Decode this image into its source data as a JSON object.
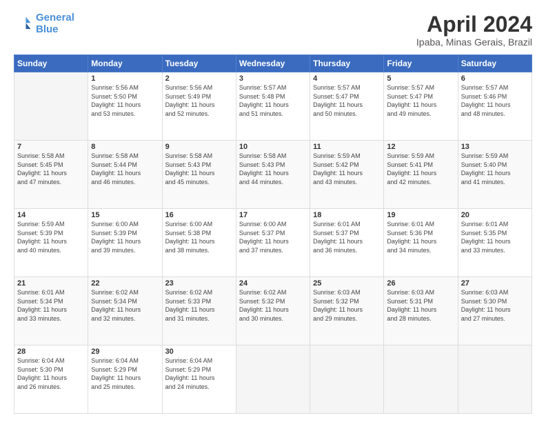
{
  "header": {
    "logo_line1": "General",
    "logo_line2": "Blue",
    "title": "April 2024",
    "subtitle": "Ipaba, Minas Gerais, Brazil"
  },
  "weekdays": [
    "Sunday",
    "Monday",
    "Tuesday",
    "Wednesday",
    "Thursday",
    "Friday",
    "Saturday"
  ],
  "weeks": [
    [
      {
        "day": "",
        "info": ""
      },
      {
        "day": "1",
        "info": "Sunrise: 5:56 AM\nSunset: 5:50 PM\nDaylight: 11 hours\nand 53 minutes."
      },
      {
        "day": "2",
        "info": "Sunrise: 5:56 AM\nSunset: 5:49 PM\nDaylight: 11 hours\nand 52 minutes."
      },
      {
        "day": "3",
        "info": "Sunrise: 5:57 AM\nSunset: 5:48 PM\nDaylight: 11 hours\nand 51 minutes."
      },
      {
        "day": "4",
        "info": "Sunrise: 5:57 AM\nSunset: 5:47 PM\nDaylight: 11 hours\nand 50 minutes."
      },
      {
        "day": "5",
        "info": "Sunrise: 5:57 AM\nSunset: 5:47 PM\nDaylight: 11 hours\nand 49 minutes."
      },
      {
        "day": "6",
        "info": "Sunrise: 5:57 AM\nSunset: 5:46 PM\nDaylight: 11 hours\nand 48 minutes."
      }
    ],
    [
      {
        "day": "7",
        "info": "Sunrise: 5:58 AM\nSunset: 5:45 PM\nDaylight: 11 hours\nand 47 minutes."
      },
      {
        "day": "8",
        "info": "Sunrise: 5:58 AM\nSunset: 5:44 PM\nDaylight: 11 hours\nand 46 minutes."
      },
      {
        "day": "9",
        "info": "Sunrise: 5:58 AM\nSunset: 5:43 PM\nDaylight: 11 hours\nand 45 minutes."
      },
      {
        "day": "10",
        "info": "Sunrise: 5:58 AM\nSunset: 5:43 PM\nDaylight: 11 hours\nand 44 minutes."
      },
      {
        "day": "11",
        "info": "Sunrise: 5:59 AM\nSunset: 5:42 PM\nDaylight: 11 hours\nand 43 minutes."
      },
      {
        "day": "12",
        "info": "Sunrise: 5:59 AM\nSunset: 5:41 PM\nDaylight: 11 hours\nand 42 minutes."
      },
      {
        "day": "13",
        "info": "Sunrise: 5:59 AM\nSunset: 5:40 PM\nDaylight: 11 hours\nand 41 minutes."
      }
    ],
    [
      {
        "day": "14",
        "info": "Sunrise: 5:59 AM\nSunset: 5:39 PM\nDaylight: 11 hours\nand 40 minutes."
      },
      {
        "day": "15",
        "info": "Sunrise: 6:00 AM\nSunset: 5:39 PM\nDaylight: 11 hours\nand 39 minutes."
      },
      {
        "day": "16",
        "info": "Sunrise: 6:00 AM\nSunset: 5:38 PM\nDaylight: 11 hours\nand 38 minutes."
      },
      {
        "day": "17",
        "info": "Sunrise: 6:00 AM\nSunset: 5:37 PM\nDaylight: 11 hours\nand 37 minutes."
      },
      {
        "day": "18",
        "info": "Sunrise: 6:01 AM\nSunset: 5:37 PM\nDaylight: 11 hours\nand 36 minutes."
      },
      {
        "day": "19",
        "info": "Sunrise: 6:01 AM\nSunset: 5:36 PM\nDaylight: 11 hours\nand 34 minutes."
      },
      {
        "day": "20",
        "info": "Sunrise: 6:01 AM\nSunset: 5:35 PM\nDaylight: 11 hours\nand 33 minutes."
      }
    ],
    [
      {
        "day": "21",
        "info": "Sunrise: 6:01 AM\nSunset: 5:34 PM\nDaylight: 11 hours\nand 33 minutes."
      },
      {
        "day": "22",
        "info": "Sunrise: 6:02 AM\nSunset: 5:34 PM\nDaylight: 11 hours\nand 32 minutes."
      },
      {
        "day": "23",
        "info": "Sunrise: 6:02 AM\nSunset: 5:33 PM\nDaylight: 11 hours\nand 31 minutes."
      },
      {
        "day": "24",
        "info": "Sunrise: 6:02 AM\nSunset: 5:32 PM\nDaylight: 11 hours\nand 30 minutes."
      },
      {
        "day": "25",
        "info": "Sunrise: 6:03 AM\nSunset: 5:32 PM\nDaylight: 11 hours\nand 29 minutes."
      },
      {
        "day": "26",
        "info": "Sunrise: 6:03 AM\nSunset: 5:31 PM\nDaylight: 11 hours\nand 28 minutes."
      },
      {
        "day": "27",
        "info": "Sunrise: 6:03 AM\nSunset: 5:30 PM\nDaylight: 11 hours\nand 27 minutes."
      }
    ],
    [
      {
        "day": "28",
        "info": "Sunrise: 6:04 AM\nSunset: 5:30 PM\nDaylight: 11 hours\nand 26 minutes."
      },
      {
        "day": "29",
        "info": "Sunrise: 6:04 AM\nSunset: 5:29 PM\nDaylight: 11 hours\nand 25 minutes."
      },
      {
        "day": "30",
        "info": "Sunrise: 6:04 AM\nSunset: 5:29 PM\nDaylight: 11 hours\nand 24 minutes."
      },
      {
        "day": "",
        "info": ""
      },
      {
        "day": "",
        "info": ""
      },
      {
        "day": "",
        "info": ""
      },
      {
        "day": "",
        "info": ""
      }
    ]
  ]
}
